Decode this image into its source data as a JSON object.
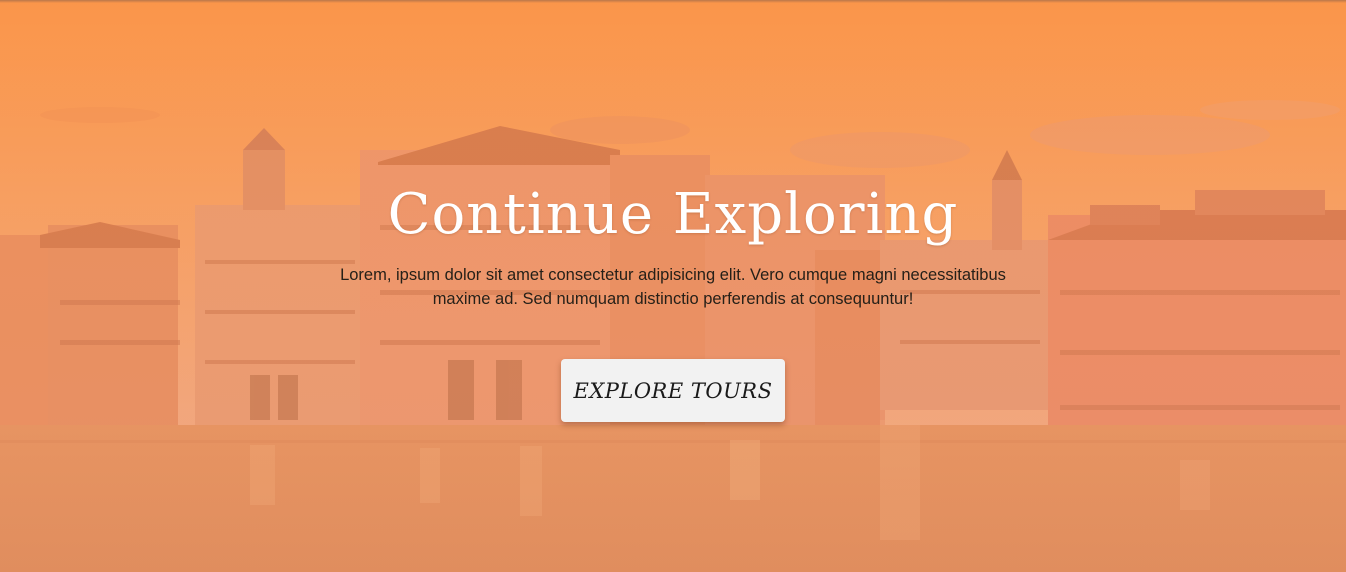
{
  "hero": {
    "title": "Continue Exploring",
    "description": "Lorem, ipsum dolor sit amet consectetur adipisicing elit. Vero cumque magni necessitatibus maxime ad. Sed numquam distinctio perferendis at consequuntur!",
    "cta_label": "EXPLORE TOURS"
  },
  "colors": {
    "overlay": "#f7a055",
    "button_bg": "#f2f2f2",
    "title": "#ffffff"
  }
}
